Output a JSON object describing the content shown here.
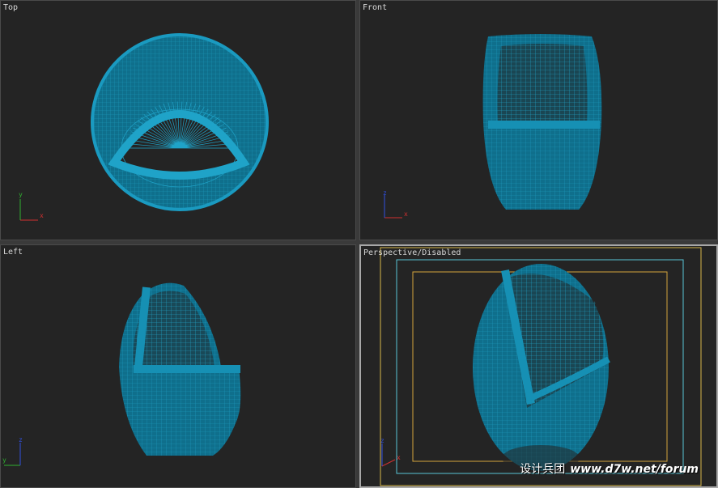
{
  "viewports": {
    "top": {
      "label": "Top",
      "axes": {
        "h": "x",
        "v": "y"
      }
    },
    "front": {
      "label": "Front",
      "axes": {
        "h": "x",
        "v": "z"
      }
    },
    "left": {
      "label": "Left",
      "axes": {
        "h": "y",
        "v": "z"
      }
    },
    "perspective": {
      "label": "Perspective/Disabled",
      "axes": {
        "h": "x",
        "v": "z"
      }
    }
  },
  "watermark": {
    "cn": "设计兵团",
    "url": "www.d7w.net/forum"
  },
  "colors": {
    "viewport_bg": "#242424",
    "wire": "#1fa3c8",
    "mesh_fill": "#0f6f8c",
    "safe_frame_outer": "#d9b84a",
    "safe_frame_action": "#58c3d6",
    "safe_frame_title": "#d4a43c",
    "axis_x": "#d03030",
    "axis_y": "#30b030",
    "axis_z": "#3050e0"
  }
}
